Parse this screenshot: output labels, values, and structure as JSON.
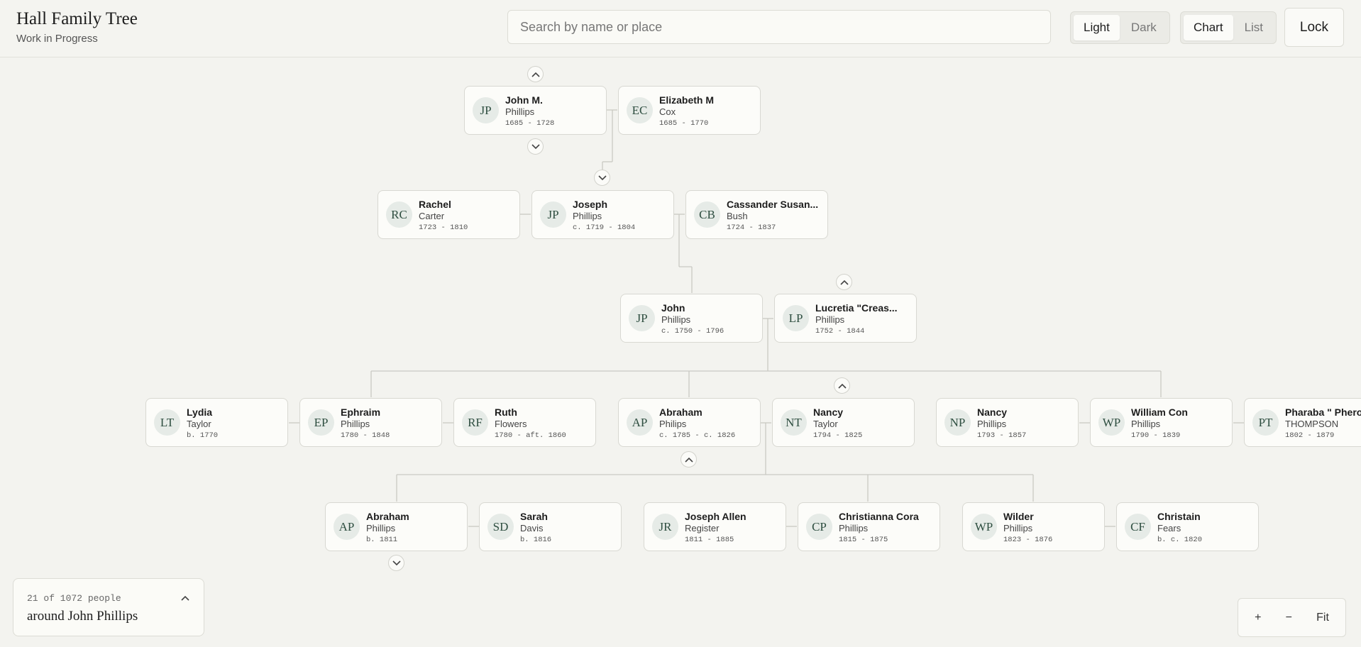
{
  "header": {
    "title": "Hall Family Tree",
    "subtitle": "Work in Progress",
    "search_placeholder": "Search by name or place",
    "theme": {
      "options": [
        "Light",
        "Dark"
      ],
      "selected": "Light"
    },
    "view": {
      "options": [
        "Chart",
        "List"
      ],
      "selected": "Chart"
    },
    "lock_label": "Lock"
  },
  "people": [
    {
      "id": "john_m",
      "initials": "JP",
      "given": "John M.",
      "surname": "Phillips",
      "dates": "1685 - 1728"
    },
    {
      "id": "elizabeth",
      "initials": "EC",
      "given": "Elizabeth M",
      "surname": "Cox",
      "dates": "1685 - 1770"
    },
    {
      "id": "rachel",
      "initials": "RC",
      "given": "Rachel",
      "surname": "Carter",
      "dates": "1723 - 1810"
    },
    {
      "id": "joseph",
      "initials": "JP",
      "given": "Joseph",
      "surname": "Phillips",
      "dates": "c. 1719 - 1804"
    },
    {
      "id": "cassander",
      "initials": "CB",
      "given": "Cassander Susan...",
      "surname": "Bush",
      "dates": "1724 - 1837"
    },
    {
      "id": "john",
      "initials": "JP",
      "given": "John",
      "surname": "Phillips",
      "dates": "c. 1750 - 1796"
    },
    {
      "id": "lucretia",
      "initials": "LP",
      "given": "Lucretia \"Creas...",
      "surname": "Phillips",
      "dates": "1752 - 1844"
    },
    {
      "id": "lydia",
      "initials": "LT",
      "given": "Lydia",
      "surname": "Taylor",
      "dates": "b. 1770"
    },
    {
      "id": "ephraim",
      "initials": "EP",
      "given": "Ephraim",
      "surname": "Phillips",
      "dates": "1780 - 1848"
    },
    {
      "id": "ruth",
      "initials": "RF",
      "given": "Ruth",
      "surname": "Flowers",
      "dates": "1780 - aft. 1860"
    },
    {
      "id": "abraham_p",
      "initials": "AP",
      "given": "Abraham",
      "surname": "Philips",
      "dates": "c. 1785 - c. 1826"
    },
    {
      "id": "nancy_t",
      "initials": "NT",
      "given": "Nancy",
      "surname": "Taylor",
      "dates": "1794 - 1825"
    },
    {
      "id": "nancy_p",
      "initials": "NP",
      "given": "Nancy",
      "surname": "Phillips",
      "dates": "1793 - 1857"
    },
    {
      "id": "william",
      "initials": "WP",
      "given": "William Con",
      "surname": "Phillips",
      "dates": "1790 - 1839"
    },
    {
      "id": "pharaba",
      "initials": "PT",
      "given": "Pharaba \" Phero...",
      "surname": "THOMPSON",
      "dates": "1802 - 1879"
    },
    {
      "id": "abraham_c",
      "initials": "AP",
      "given": "Abraham",
      "surname": "Phillips",
      "dates": "b. 1811"
    },
    {
      "id": "sarah",
      "initials": "SD",
      "given": "Sarah",
      "surname": "Davis",
      "dates": "b. 1816"
    },
    {
      "id": "joseph_allen",
      "initials": "JR",
      "given": "Joseph Allen",
      "surname": "Register",
      "dates": "1811 - 1885"
    },
    {
      "id": "christianna",
      "initials": "CP",
      "given": "Christianna Cora",
      "surname": "Phillips",
      "dates": "1815 - 1875"
    },
    {
      "id": "wilder",
      "initials": "WP",
      "given": "Wilder",
      "surname": "Phillips",
      "dates": "1823 - 1876"
    },
    {
      "id": "christain",
      "initials": "CF",
      "given": "Christain",
      "surname": "Fears",
      "dates": "b. c. 1820"
    }
  ],
  "info_panel": {
    "count": "21 of 1072 people",
    "focus": "around John Phillips"
  },
  "zoom": {
    "in_label": "+",
    "out_label": "−",
    "fit_label": "Fit"
  },
  "colors": {
    "background": "#f3f3ef",
    "card": "#fcfcf9",
    "avatar": "#e6ebe7",
    "avatar_text": "#2f4f41",
    "connector": "#c9c9c3"
  }
}
